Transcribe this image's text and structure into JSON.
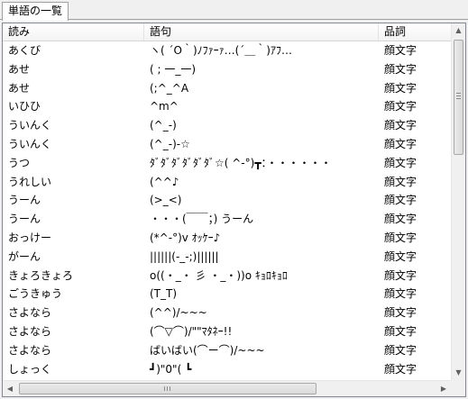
{
  "tab": {
    "label": "単語の一覧"
  },
  "columns": [
    "読み",
    "語句",
    "品詞"
  ],
  "rows": [
    {
      "yomi": "あくび",
      "goku": "ヽ( ´O｀)ﾉﾌｧｰｧ…(´＿｀)ｱﾌ…",
      "hinshi": "顔文字"
    },
    {
      "yomi": "あせ",
      "goku": "( ; 一_一)",
      "hinshi": "顔文字"
    },
    {
      "yomi": "あせ",
      "goku": "(;^_^A",
      "hinshi": "顔文字"
    },
    {
      "yomi": "いひひ",
      "goku": "^m^",
      "hinshi": "顔文字"
    },
    {
      "yomi": "ういんく",
      "goku": "(^_-)",
      "hinshi": "顔文字"
    },
    {
      "yomi": "ういんく",
      "goku": "(^_-)-☆",
      "hinshi": "顔文字"
    },
    {
      "yomi": "うつ",
      "goku": "ﾀﾞﾀﾞﾀﾞﾀﾞﾀﾞﾀﾞ☆( ^-°)┳：・・・・・・",
      "hinshi": "顔文字"
    },
    {
      "yomi": "うれしい",
      "goku": "(^^♪",
      "hinshi": "顔文字"
    },
    {
      "yomi": "うーん",
      "goku": "(>_<)",
      "hinshi": "顔文字"
    },
    {
      "yomi": "うーん",
      "goku": "・・・(￣￣；) うーん",
      "hinshi": "顔文字"
    },
    {
      "yomi": "おっけー",
      "goku": "(*^-°)v ｵｯｹｰ♪",
      "hinshi": "顔文字"
    },
    {
      "yomi": "がーん",
      "goku": "||||||(-_-;)||||||",
      "hinshi": "顔文字"
    },
    {
      "yomi": "きょろきょろ",
      "goku": "o((・_・ 彡 ・_・))o ｷｮﾛｷｮﾛ",
      "hinshi": "顔文字"
    },
    {
      "yomi": "ごうきゅう",
      "goku": "(T_T)",
      "hinshi": "顔文字"
    },
    {
      "yomi": "さよなら",
      "goku": "(^^)/~~~",
      "hinshi": "顔文字"
    },
    {
      "yomi": "さよなら",
      "goku": "(⌒▽⌒)/\"\"ﾏﾀﾈｰ!!",
      "hinshi": "顔文字"
    },
    {
      "yomi": "さよなら",
      "goku": "ばいばい(⌒ー⌒)/~~~",
      "hinshi": "顔文字"
    },
    {
      "yomi": "しょっく",
      "goku": "┛)\"0\"( ┗",
      "hinshi": "顔文字"
    }
  ],
  "icons": {
    "scroll_up": "scroll-up-arrow-icon",
    "scroll_down": "scroll-down-arrow-icon",
    "scroll_left": "scroll-left-arrow-icon",
    "scroll_right": "scroll-right-arrow-icon"
  },
  "colors": {
    "border": "#828790",
    "background": "#ffffff",
    "chrome": "#f0f0f0"
  }
}
